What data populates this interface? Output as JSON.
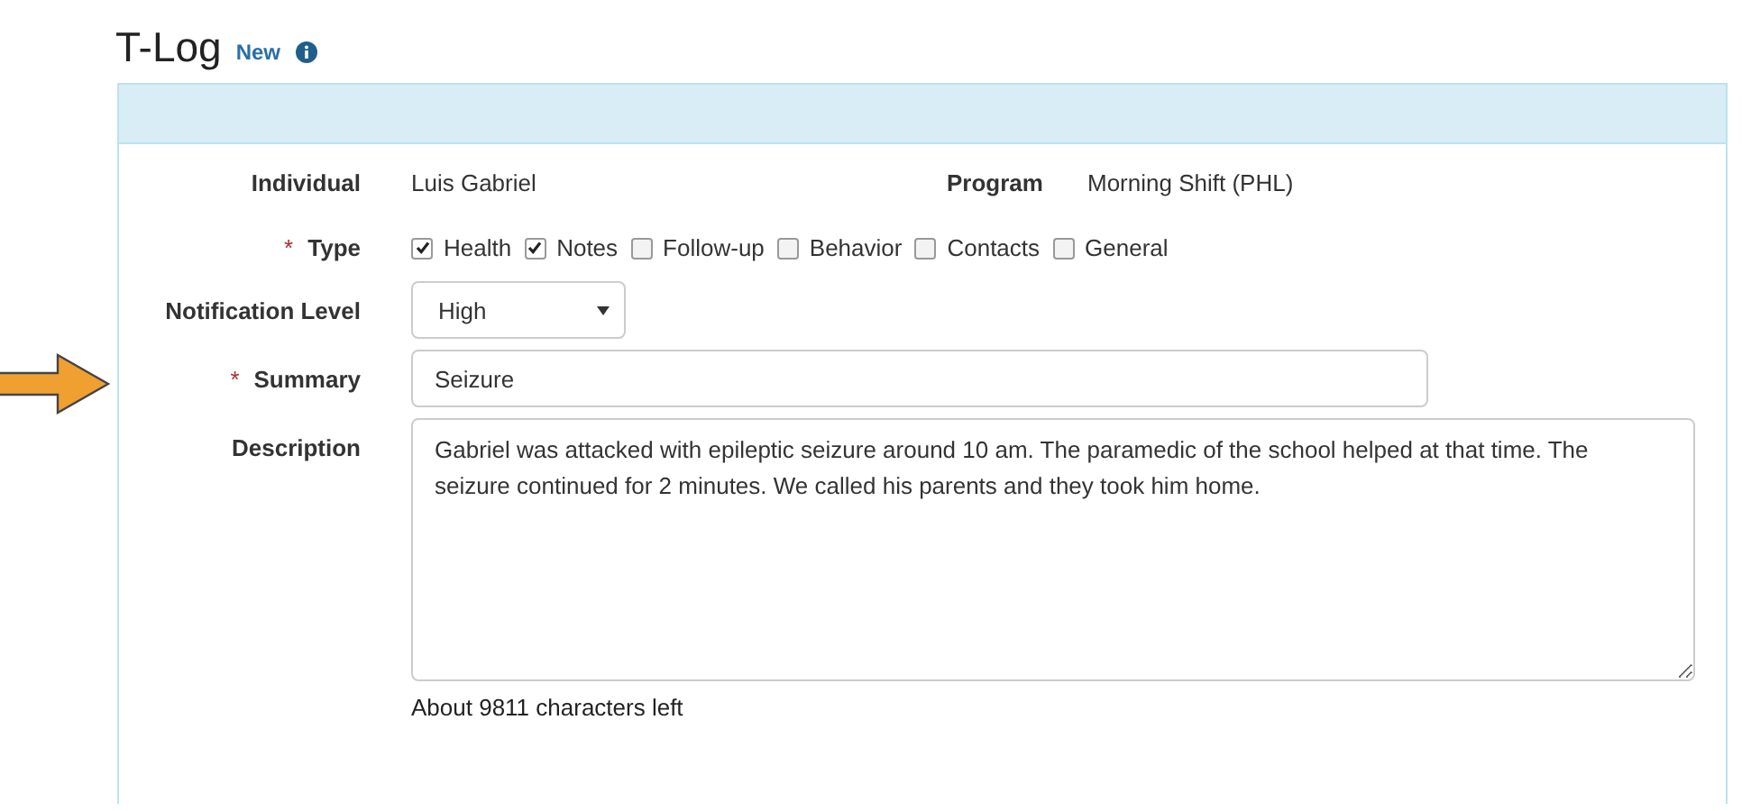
{
  "page": {
    "title": "T-Log",
    "badge": "New"
  },
  "individual": {
    "label": "Individual",
    "value": "Luis Gabriel"
  },
  "program": {
    "label": "Program",
    "value": "Morning Shift (PHL)"
  },
  "type": {
    "label": "Type",
    "required_mark": "*",
    "options": [
      {
        "label": "Health",
        "checked": true
      },
      {
        "label": "Notes",
        "checked": true
      },
      {
        "label": "Follow-up",
        "checked": false
      },
      {
        "label": "Behavior",
        "checked": false
      },
      {
        "label": "Contacts",
        "checked": false
      },
      {
        "label": "General",
        "checked": false
      }
    ]
  },
  "notification_level": {
    "label": "Notification Level",
    "value": "High"
  },
  "summary": {
    "label": "Summary",
    "required_mark": "*",
    "value": "Seizure",
    "highlighted": true
  },
  "description": {
    "label": "Description",
    "value": "Gabriel was attacked with epileptic seizure around 10 am. The paramedic of the school helped at that time. The seizure continued for 2 minutes. We called his parents and they took him home.",
    "help": "About 9811 characters left"
  }
}
